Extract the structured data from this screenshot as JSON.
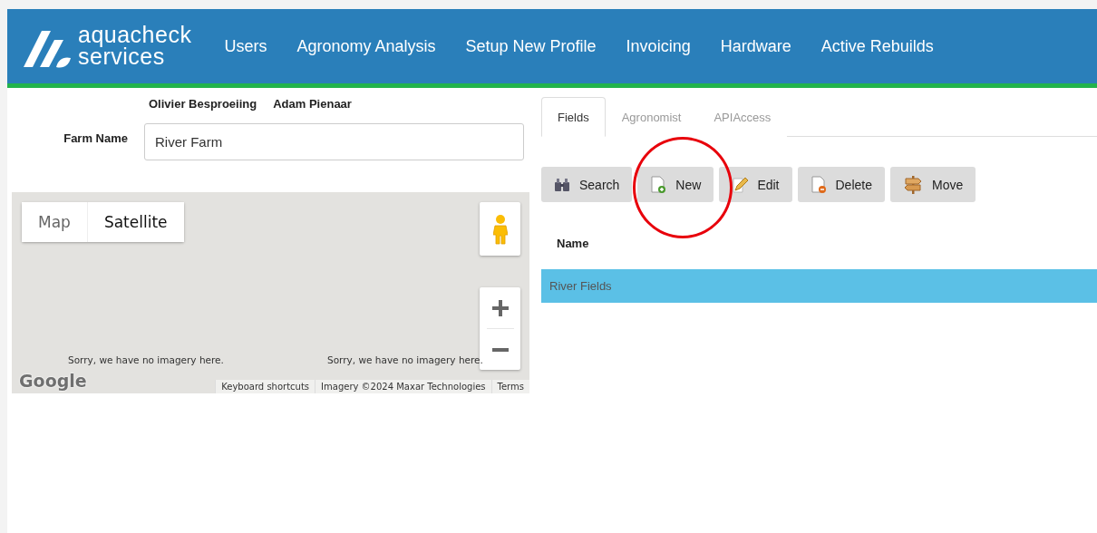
{
  "header": {
    "logo": {
      "line_1": "aquacheck",
      "line_2": "services"
    },
    "nav": [
      "Users",
      "Agronomy Analysis",
      "Setup New Profile",
      "Invoicing",
      "Hardware",
      "Active Rebuilds"
    ]
  },
  "farm": {
    "owners": [
      "Olivier Besproeiing",
      "Adam Pienaar"
    ],
    "field_label": "Farm Name",
    "field_value": "River Farm"
  },
  "map": {
    "map_types": [
      {
        "label": "Map",
        "selected": false
      },
      {
        "label": "Satellite",
        "selected": true
      }
    ],
    "notices": [
      "Sorry, we have no imagery here.",
      "Sorry, we have no imagery here."
    ],
    "logo": "Google",
    "footer_links": [
      "Keyboard shortcuts",
      "Imagery ©2024 Maxar Technologies",
      "Terms"
    ]
  },
  "tabs": [
    {
      "label": "Fields",
      "selected": true
    },
    {
      "label": "Agronomist",
      "selected": false
    },
    {
      "label": "APIAccess",
      "selected": false
    }
  ],
  "toolbar": [
    {
      "kind": "search",
      "label": "Search"
    },
    {
      "kind": "new",
      "label": "New"
    },
    {
      "kind": "edit",
      "label": "Edit"
    },
    {
      "kind": "delete",
      "label": "Delete"
    },
    {
      "kind": "move",
      "label": "Move"
    }
  ],
  "table": {
    "columns": [
      "Name"
    ],
    "rows": [
      {
        "name": "River Fields",
        "selected": true
      }
    ]
  }
}
